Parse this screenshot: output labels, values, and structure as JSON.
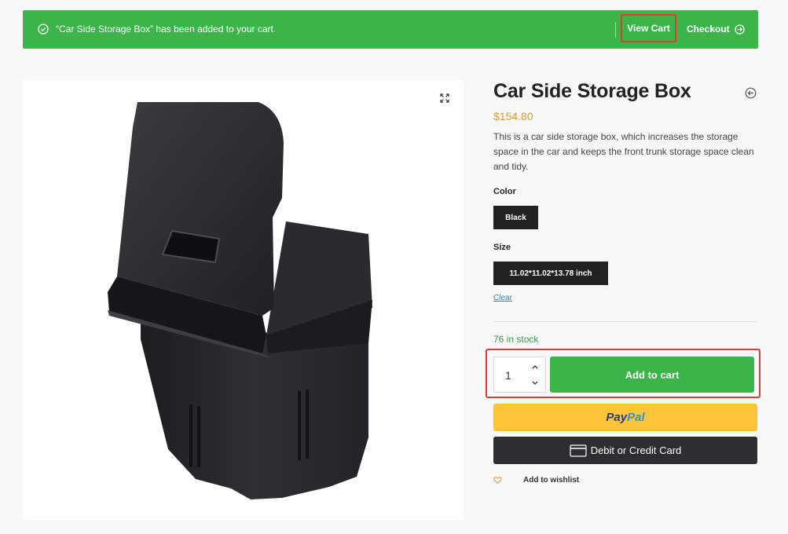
{
  "notice": {
    "message": "“Car Side Storage Box” has been added to your cart.",
    "view_cart": "View Cart",
    "checkout": "Checkout"
  },
  "product": {
    "title": "Car Side Storage Box",
    "price": "$154.80",
    "description": "This is a car side storage box, which increases the storage space in the car and keeps the front trunk storage space clean and tidy.",
    "color_label": "Color",
    "color_value": "Black",
    "size_label": "Size",
    "size_value": "11.02*11.02*13.78 inch",
    "clear": "Clear",
    "stock": "76 in stock",
    "quantity": "1",
    "add_to_cart": "Add to cart"
  },
  "payments": {
    "paypal_part1": "Pay",
    "paypal_part2": "Pal",
    "card": "Debit or Credit Card"
  },
  "wishlist": {
    "label": "Add to wishlist"
  },
  "colors": {
    "notice_green": "#3bb54a",
    "highlight_red": "#e53935",
    "price_gold": "#d59b3a",
    "paypal_yellow": "#ffc439",
    "card_dark": "#2c2e2f"
  },
  "icons": [
    "check-circle-icon",
    "arrow-right-circle-icon",
    "expand-icon",
    "back-circle-icon",
    "chevron-up-icon",
    "chevron-down-icon",
    "credit-card-icon",
    "heart-icon"
  ]
}
